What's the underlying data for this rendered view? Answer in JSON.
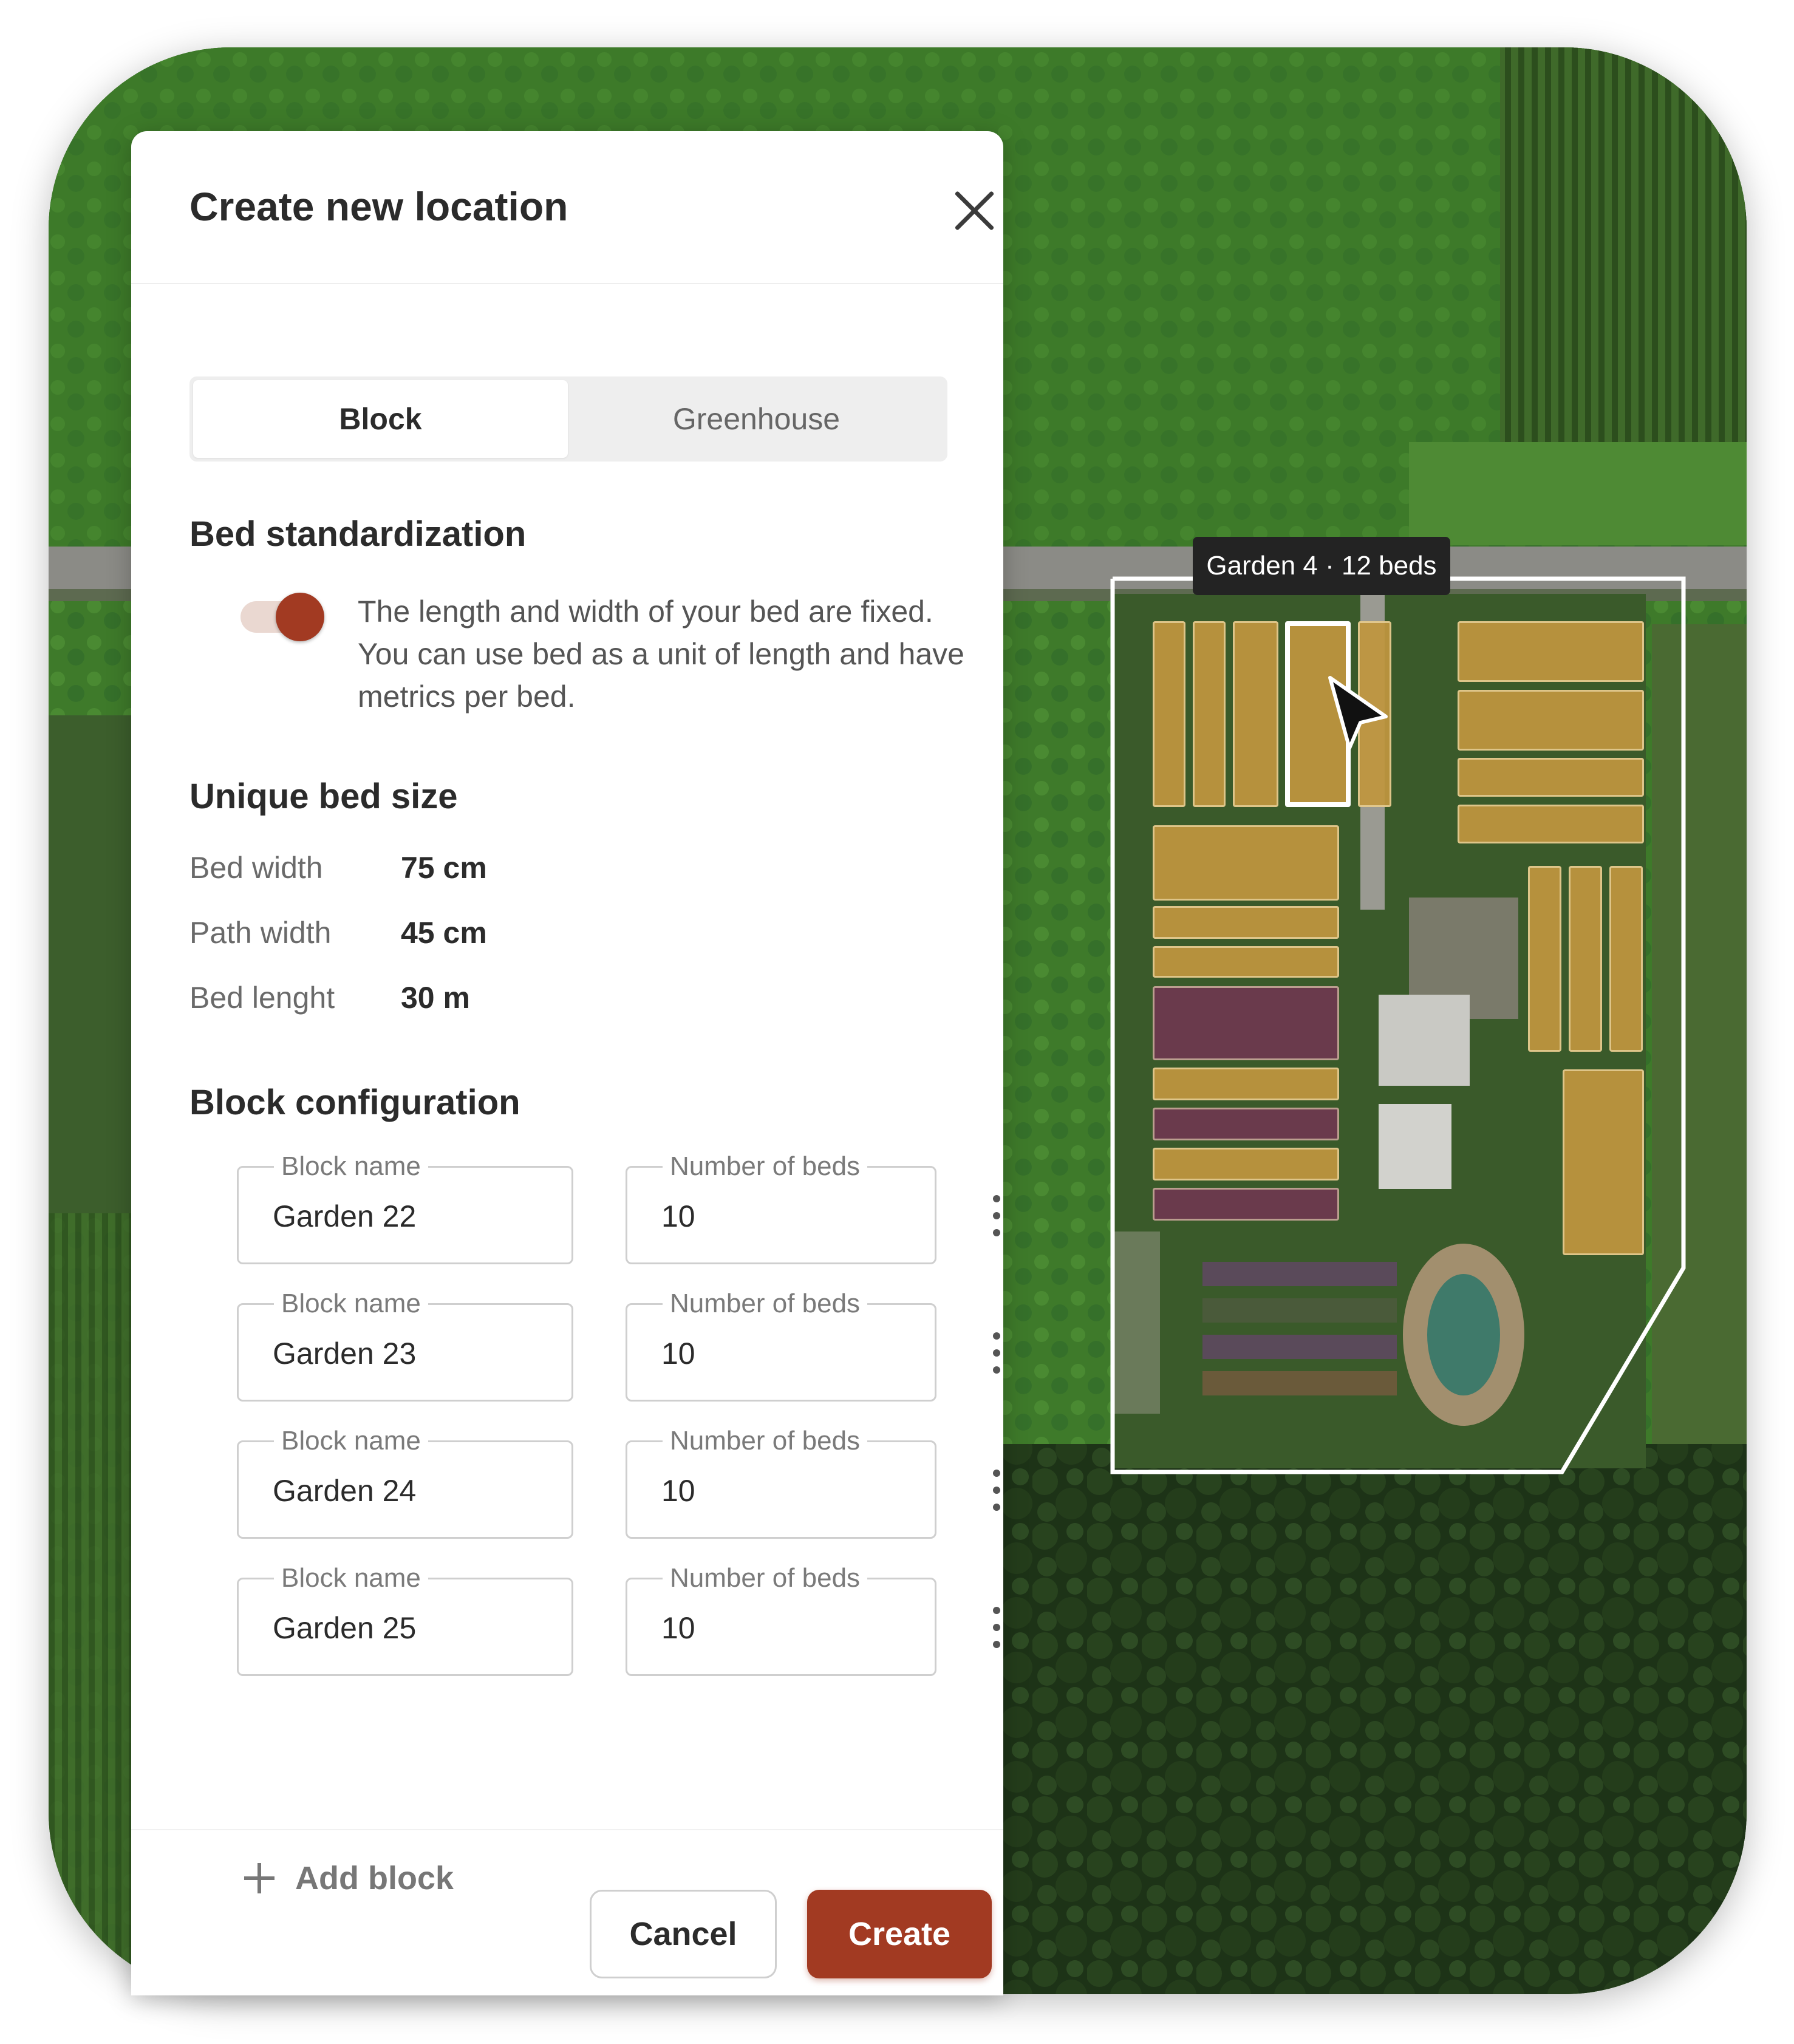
{
  "dialog": {
    "title": "Create new location",
    "close_icon": "close-icon",
    "tabs": [
      {
        "label": "Block",
        "selected": true
      },
      {
        "label": "Greenhouse",
        "selected": false
      }
    ]
  },
  "bed_standardization": {
    "title": "Bed standardization",
    "toggle_on": true,
    "description": "The length and width of your bed are fixed. You can use bed as a unit of length and have metrics per bed."
  },
  "unique_bed_size": {
    "title": "Unique bed size",
    "rows": [
      {
        "label": "Bed width",
        "value": "75 cm"
      },
      {
        "label": "Path width",
        "value": "45 cm"
      },
      {
        "label": "Bed lenght",
        "value": "30 m"
      }
    ]
  },
  "block_configuration": {
    "title": "Block configuration",
    "blocks": [
      {
        "name_label": "Block name",
        "name": "Garden 22",
        "beds_label": "Number of beds",
        "beds": "10"
      },
      {
        "name_label": "Block name",
        "name": "Garden 23",
        "beds_label": "Number of beds",
        "beds": "10"
      },
      {
        "name_label": "Block name",
        "name": "Garden 24",
        "beds_label": "Number of beds",
        "beds": "10"
      },
      {
        "name_label": "Block name",
        "name": "Garden 25",
        "beds_label": "Number of beds",
        "beds": "10"
      }
    ],
    "add_label": "Add block"
  },
  "footer": {
    "cancel_label": "Cancel",
    "create_label": "Create"
  },
  "map": {
    "garden_tag": "Garden 4 · 12 beds"
  },
  "colors": {
    "accent": "#a23a22",
    "bed_yellow": "#bf963e",
    "bed_purple": "#703650"
  }
}
